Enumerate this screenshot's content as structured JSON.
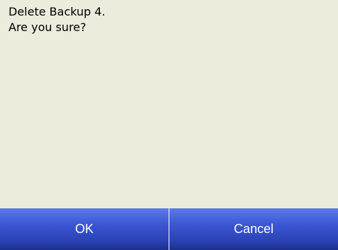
{
  "dialog": {
    "message_line1": "Delete Backup 4.",
    "message_line2": "Are you sure?"
  },
  "buttons": {
    "ok_label": "OK",
    "cancel_label": "Cancel"
  },
  "colors": {
    "background": "#ecebdc",
    "button_top": "#5b7ae8",
    "button_bottom": "#1c2f8f",
    "button_text": "#ffffff",
    "divider": "#ffffff"
  }
}
